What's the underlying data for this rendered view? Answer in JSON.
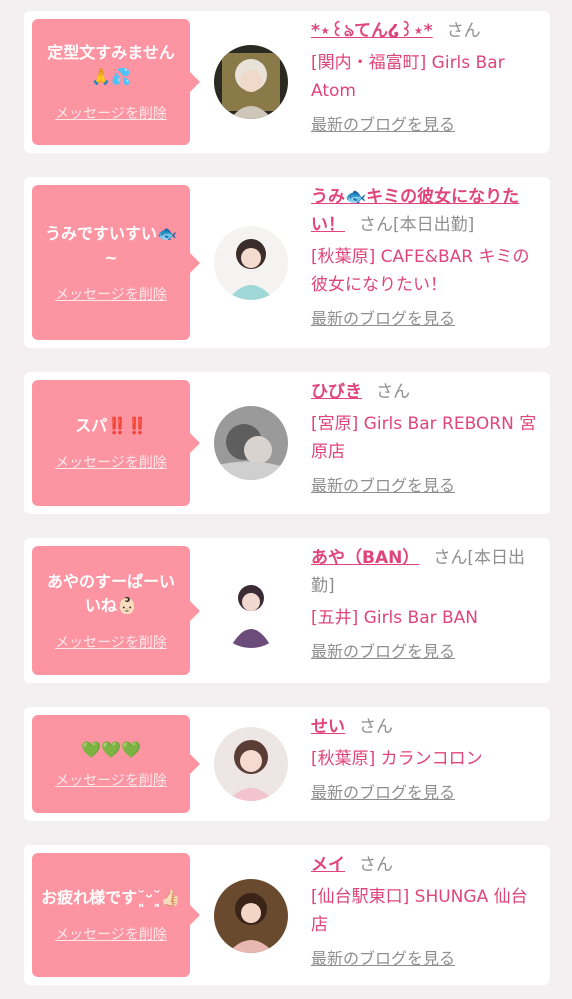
{
  "delete_label": "メッセージを削除",
  "san_label": "さん",
  "blog_label": "最新のブログを見る",
  "colors": {
    "bubble": "#fd94a2",
    "accent": "#e0457a",
    "muted": "#8f8f8f",
    "background": "#f4f0f1"
  },
  "entries": [
    {
      "message": "定型文すみません🙏💦",
      "name": "*⋆꒰ঌてん໒꒱⋆*",
      "today": "",
      "shop": "[関内・福富町] Girls Bar Atom",
      "avatar_icon": "girl-photo-icon"
    },
    {
      "message": "うみですいすい🐟~",
      "name": "うみ🐟キミの彼女になりたい！",
      "today": "[本日出勤]",
      "shop": "[秋葉原] CAFE&BAR キミの彼女になりたい！",
      "avatar_icon": "girl-photo-icon"
    },
    {
      "message": "スパ‼️‼️",
      "name": "ひびき",
      "today": "",
      "shop": "[宮原] Girls Bar REBORN 宮原店",
      "avatar_icon": "girl-photo-icon"
    },
    {
      "message": "あやのすーぱーいいね👶🏻",
      "name": "あや（BAN）",
      "today": "[本日出勤]",
      "shop": "[五井] Girls Bar BAN",
      "avatar_icon": "girl-photo-icon"
    },
    {
      "message": "💚💚💚",
      "name": "せい",
      "today": "",
      "shop": "[秋葉原] カランコロン",
      "avatar_icon": "girl-photo-icon"
    },
    {
      "message": "お疲れ様です˘͈ᵕ˘͈👍🏻",
      "name": "メイ",
      "today": "",
      "shop": "[仙台駅東口] SHUNGA 仙台店",
      "avatar_icon": "girl-photo-icon"
    }
  ]
}
